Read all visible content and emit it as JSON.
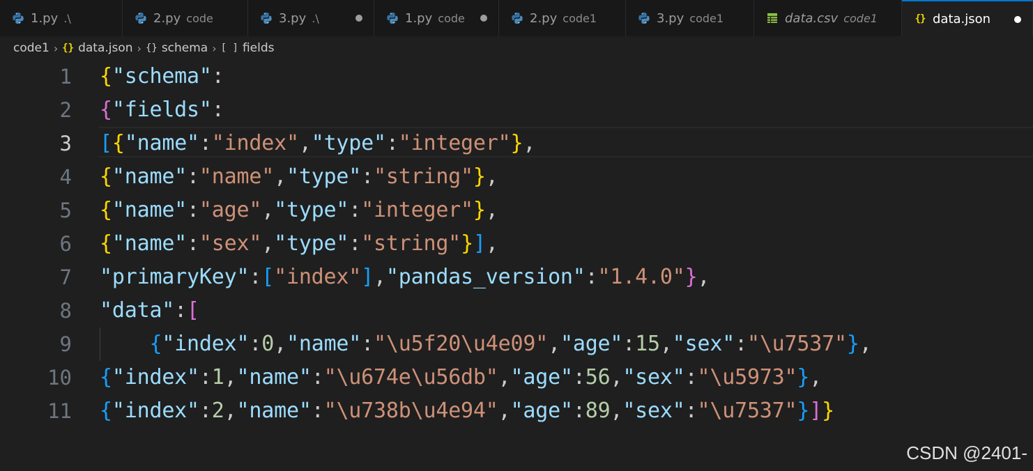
{
  "tabs": [
    {
      "name": "1.py",
      "desc": ".\\",
      "icon": "python-icon",
      "dirty": false,
      "active": false,
      "italic": false
    },
    {
      "name": "2.py",
      "desc": "code",
      "icon": "python-icon",
      "dirty": false,
      "active": false,
      "italic": false
    },
    {
      "name": "3.py",
      "desc": ".\\",
      "icon": "python-icon",
      "dirty": true,
      "active": false,
      "italic": false
    },
    {
      "name": "1.py",
      "desc": "code",
      "icon": "python-icon",
      "dirty": true,
      "active": false,
      "italic": false
    },
    {
      "name": "2.py",
      "desc": "code1",
      "icon": "python-icon",
      "dirty": false,
      "active": false,
      "italic": false
    },
    {
      "name": "3.py",
      "desc": "code1",
      "icon": "python-icon",
      "dirty": false,
      "active": false,
      "italic": false
    },
    {
      "name": "data.csv",
      "desc": "code1",
      "icon": "csv-table-icon",
      "dirty": false,
      "active": false,
      "italic": true
    },
    {
      "name": "data.json",
      "desc": "",
      "icon": "json-braces-icon",
      "dirty": true,
      "active": true,
      "italic": false
    }
  ],
  "breadcrumb": [
    {
      "label": "code1",
      "icon": ""
    },
    {
      "label": "data.json",
      "icon": "json-braces-icon"
    },
    {
      "label": "schema",
      "icon": "object-braces-icon"
    },
    {
      "label": "fields",
      "icon": "array-brackets-icon"
    }
  ],
  "editor": {
    "current_line": 3,
    "lines": [
      {
        "n": "1",
        "tokens": [
          [
            "b1",
            "{"
          ],
          [
            "key",
            "\"schema\""
          ],
          [
            "punc",
            ":"
          ]
        ]
      },
      {
        "n": "2",
        "tokens": [
          [
            "b2",
            "{"
          ],
          [
            "key",
            "\"fields\""
          ],
          [
            "punc",
            ":"
          ]
        ]
      },
      {
        "n": "3",
        "tokens": [
          [
            "b3",
            "["
          ],
          [
            "b1",
            "{"
          ],
          [
            "key",
            "\"name\""
          ],
          [
            "punc",
            ":"
          ],
          [
            "str",
            "\"index\""
          ],
          [
            "punc",
            ","
          ],
          [
            "key",
            "\"type\""
          ],
          [
            "punc",
            ":"
          ],
          [
            "str",
            "\"integer\""
          ],
          [
            "b1",
            "}"
          ],
          [
            "punc",
            ","
          ]
        ]
      },
      {
        "n": "4",
        "tokens": [
          [
            "b1",
            "{"
          ],
          [
            "key",
            "\"name\""
          ],
          [
            "punc",
            ":"
          ],
          [
            "str",
            "\"name\""
          ],
          [
            "punc",
            ","
          ],
          [
            "key",
            "\"type\""
          ],
          [
            "punc",
            ":"
          ],
          [
            "str",
            "\"string\""
          ],
          [
            "b1",
            "}"
          ],
          [
            "punc",
            ","
          ]
        ]
      },
      {
        "n": "5",
        "tokens": [
          [
            "b1",
            "{"
          ],
          [
            "key",
            "\"name\""
          ],
          [
            "punc",
            ":"
          ],
          [
            "str",
            "\"age\""
          ],
          [
            "punc",
            ","
          ],
          [
            "key",
            "\"type\""
          ],
          [
            "punc",
            ":"
          ],
          [
            "str",
            "\"integer\""
          ],
          [
            "b1",
            "}"
          ],
          [
            "punc",
            ","
          ]
        ]
      },
      {
        "n": "6",
        "tokens": [
          [
            "b1",
            "{"
          ],
          [
            "key",
            "\"name\""
          ],
          [
            "punc",
            ":"
          ],
          [
            "str",
            "\"sex\""
          ],
          [
            "punc",
            ","
          ],
          [
            "key",
            "\"type\""
          ],
          [
            "punc",
            ":"
          ],
          [
            "str",
            "\"string\""
          ],
          [
            "b1",
            "}"
          ],
          [
            "b3",
            "]"
          ],
          [
            "punc",
            ","
          ]
        ]
      },
      {
        "n": "7",
        "tokens": [
          [
            "key",
            "\"primaryKey\""
          ],
          [
            "punc",
            ":"
          ],
          [
            "b3",
            "["
          ],
          [
            "str",
            "\"index\""
          ],
          [
            "b3",
            "]"
          ],
          [
            "punc",
            ","
          ],
          [
            "key",
            "\"pandas_version\""
          ],
          [
            "punc",
            ":"
          ],
          [
            "str",
            "\"1.4.0\""
          ],
          [
            "b2",
            "}"
          ],
          [
            "punc",
            ","
          ]
        ]
      },
      {
        "n": "8",
        "tokens": [
          [
            "key",
            "\"data\""
          ],
          [
            "punc",
            ":"
          ],
          [
            "b2",
            "["
          ]
        ]
      },
      {
        "n": "9",
        "indent": "    ",
        "tokens": [
          [
            "b3",
            "{"
          ],
          [
            "key",
            "\"index\""
          ],
          [
            "punc",
            ":"
          ],
          [
            "num",
            "0"
          ],
          [
            "punc",
            ","
          ],
          [
            "key",
            "\"name\""
          ],
          [
            "punc",
            ":"
          ],
          [
            "str",
            "\"\\u5f20\\u4e09\""
          ],
          [
            "punc",
            ","
          ],
          [
            "key",
            "\"age\""
          ],
          [
            "punc",
            ":"
          ],
          [
            "num",
            "15"
          ],
          [
            "punc",
            ","
          ],
          [
            "key",
            "\"sex\""
          ],
          [
            "punc",
            ":"
          ],
          [
            "str",
            "\"\\u7537\""
          ],
          [
            "b3",
            "}"
          ],
          [
            "punc",
            ","
          ]
        ]
      },
      {
        "n": "10",
        "tokens": [
          [
            "b3",
            "{"
          ],
          [
            "key",
            "\"index\""
          ],
          [
            "punc",
            ":"
          ],
          [
            "num",
            "1"
          ],
          [
            "punc",
            ","
          ],
          [
            "key",
            "\"name\""
          ],
          [
            "punc",
            ":"
          ],
          [
            "str",
            "\"\\u674e\\u56db\""
          ],
          [
            "punc",
            ","
          ],
          [
            "key",
            "\"age\""
          ],
          [
            "punc",
            ":"
          ],
          [
            "num",
            "56"
          ],
          [
            "punc",
            ","
          ],
          [
            "key",
            "\"sex\""
          ],
          [
            "punc",
            ":"
          ],
          [
            "str",
            "\"\\u5973\""
          ],
          [
            "b3",
            "}"
          ],
          [
            "punc",
            ","
          ]
        ]
      },
      {
        "n": "11",
        "tokens": [
          [
            "b3",
            "{"
          ],
          [
            "key",
            "\"index\""
          ],
          [
            "punc",
            ":"
          ],
          [
            "num",
            "2"
          ],
          [
            "punc",
            ","
          ],
          [
            "key",
            "\"name\""
          ],
          [
            "punc",
            ":"
          ],
          [
            "str",
            "\"\\u738b\\u4e94\""
          ],
          [
            "punc",
            ","
          ],
          [
            "key",
            "\"age\""
          ],
          [
            "punc",
            ":"
          ],
          [
            "num",
            "89"
          ],
          [
            "punc",
            ","
          ],
          [
            "key",
            "\"sex\""
          ],
          [
            "punc",
            ":"
          ],
          [
            "str",
            "\"\\u7537\""
          ],
          [
            "b3",
            "}"
          ],
          [
            "b2",
            "]"
          ],
          [
            "b1",
            "}"
          ]
        ]
      }
    ]
  },
  "watermark": "CSDN @2401-",
  "colors": {
    "accent": "#0078d4",
    "json_key": "#9cdcfe",
    "json_string": "#ce9178",
    "json_number": "#b5cea8",
    "bracket_level1": "#ffd700",
    "bracket_level2": "#da70d6",
    "bracket_level3": "#179fff"
  }
}
